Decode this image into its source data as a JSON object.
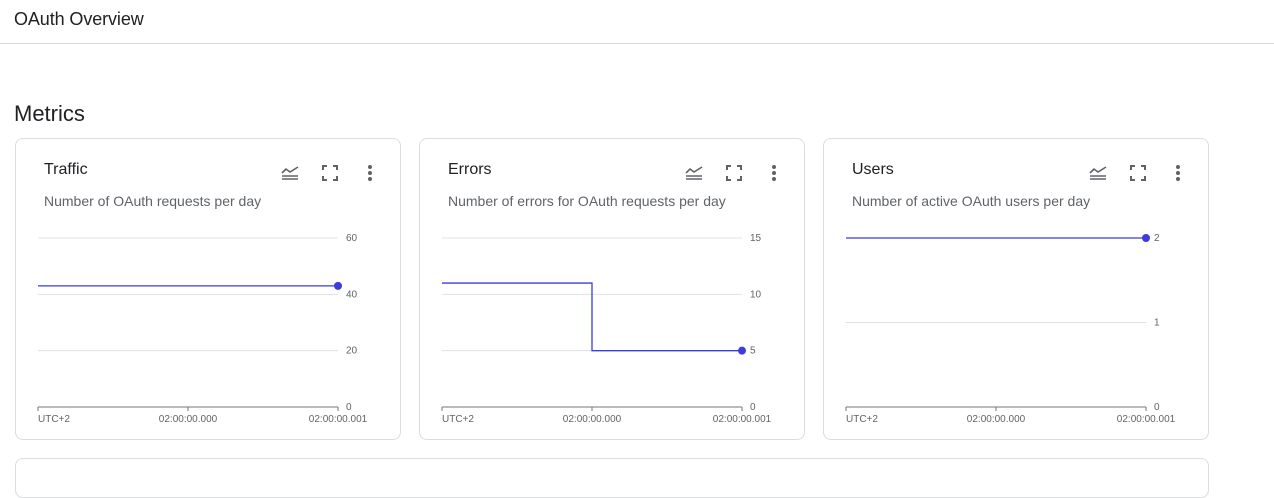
{
  "header": {
    "title": "OAuth Overview"
  },
  "section": {
    "title": "Metrics"
  },
  "colors": {
    "line": "#3c3cdc",
    "grid": "#e0e0e0",
    "axis": "#757575"
  },
  "icons": {
    "compare": "compare-lines-icon",
    "fullscreen": "fullscreen-icon",
    "more": "more-vert-icon"
  },
  "cards": [
    {
      "title": "Traffic",
      "subtitle": "Number of OAuth requests per day",
      "chart_data": {
        "type": "line",
        "step": true,
        "x_ticks": [
          "UTC+2",
          "02:00:00.000",
          "02:00:00.001"
        ],
        "y_ticks": [
          "0",
          "20",
          "40",
          "60"
        ],
        "ylim": [
          0,
          60
        ],
        "y_axis_side": "right",
        "series": [
          {
            "values": [
              43,
              43,
              43
            ]
          }
        ]
      }
    },
    {
      "title": "Errors",
      "subtitle": "Number of errors for OAuth requests per day",
      "chart_data": {
        "type": "line",
        "step": true,
        "x_ticks": [
          "UTC+2",
          "02:00:00.000",
          "02:00:00.001"
        ],
        "y_ticks": [
          "0",
          "5",
          "10",
          "15"
        ],
        "ylim": [
          0,
          15
        ],
        "y_axis_side": "right",
        "series": [
          {
            "values": [
              11,
              5,
              5
            ]
          }
        ]
      }
    },
    {
      "title": "Users",
      "subtitle": "Number of active OAuth users per day",
      "chart_data": {
        "type": "line",
        "step": true,
        "x_ticks": [
          "UTC+2",
          "02:00:00.000",
          "02:00:00.001"
        ],
        "y_ticks": [
          "0",
          "1",
          "2"
        ],
        "ylim": [
          0,
          2
        ],
        "y_axis_side": "right",
        "series": [
          {
            "values": [
              2,
              2,
              2
            ]
          }
        ]
      }
    }
  ]
}
